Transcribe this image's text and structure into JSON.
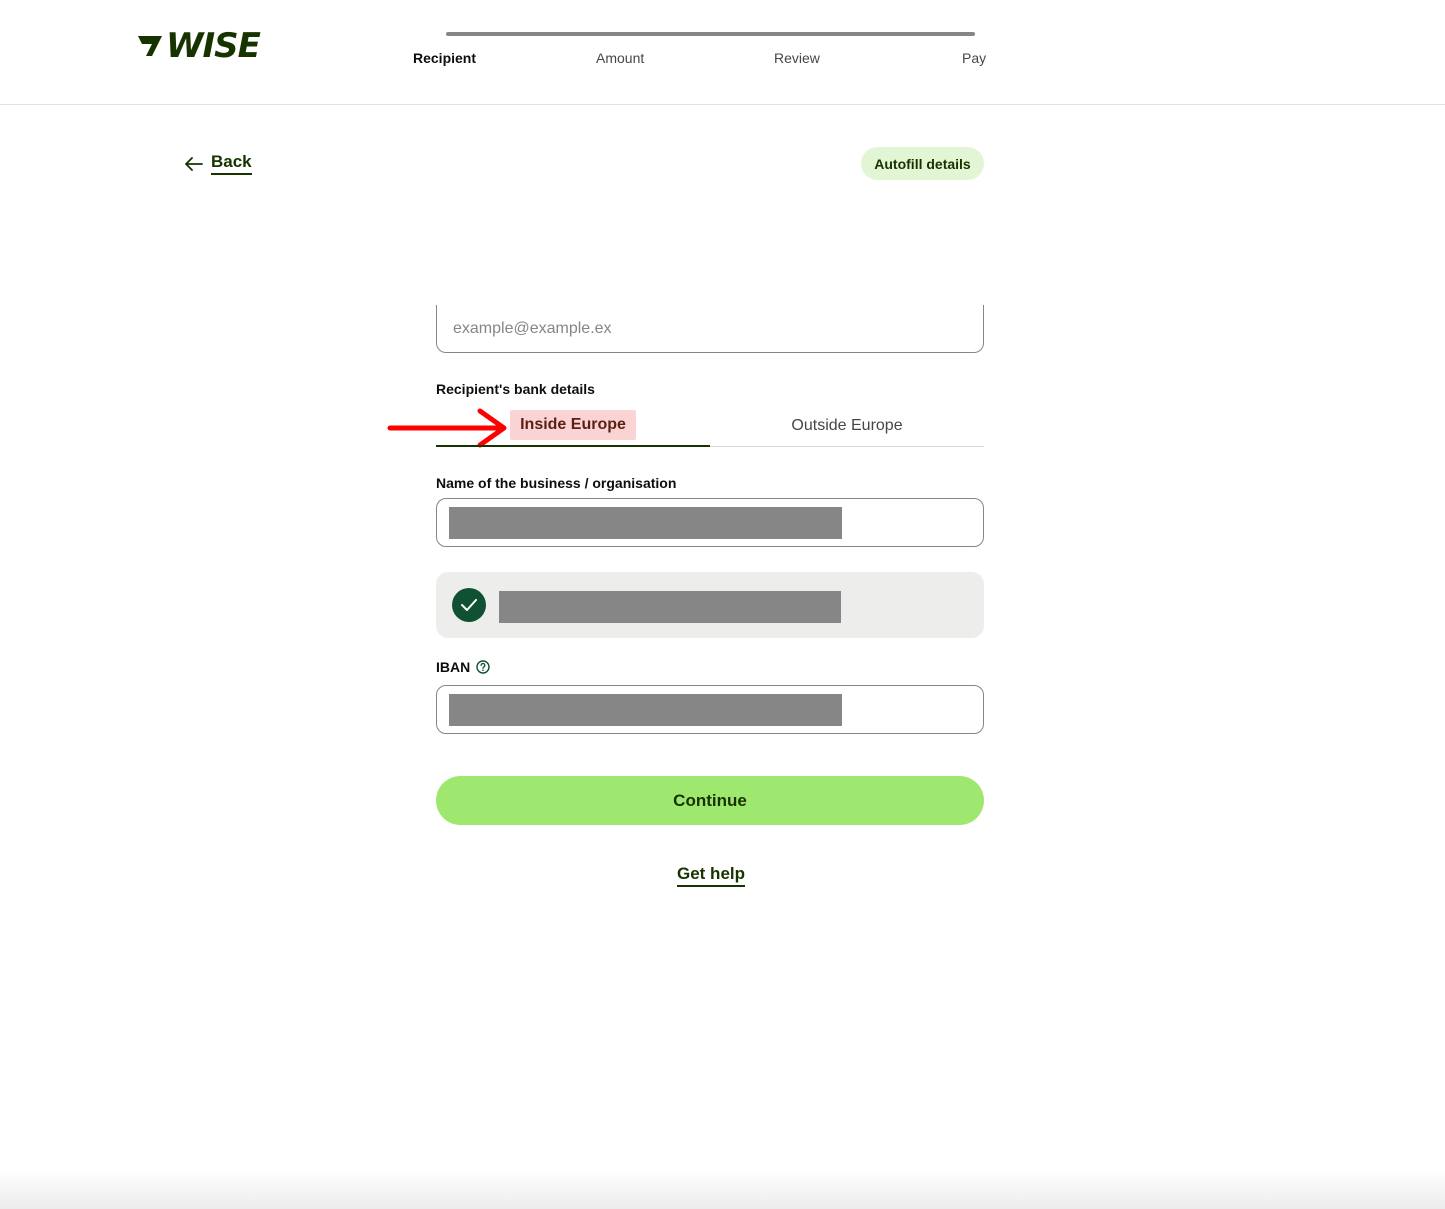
{
  "header": {
    "logo_text": "WISE",
    "brand_color": "#163300",
    "steps": [
      {
        "label": "Recipient",
        "active": true
      },
      {
        "label": "Amount",
        "active": false
      },
      {
        "label": "Review",
        "active": false
      },
      {
        "label": "Pay",
        "active": false
      }
    ]
  },
  "nav": {
    "back_label": "Back",
    "back_icon": "arrow-left-icon",
    "autofill_label": "Autofill details"
  },
  "form": {
    "email": {
      "placeholder": "example@example.ex",
      "value": ""
    },
    "bank_details_label": "Recipient's bank details",
    "tabs": [
      {
        "label": "Inside Europe",
        "selected": true
      },
      {
        "label": "Outside Europe",
        "selected": false
      }
    ],
    "business_name_label": "Name of the business / organisation",
    "business_name_value": "[redacted]",
    "verified_name_value": "[redacted]",
    "verified_icon": "check-circle-icon",
    "iban_label": "IBAN",
    "iban_help_icon": "question-circle-icon",
    "iban_value": "[redacted]",
    "continue_label": "Continue",
    "get_help_label": "Get help"
  },
  "annotation": {
    "arrow_icon": "red-arrow-icon",
    "arrow_color": "#ff0000",
    "highlight_color": "#fad4d4"
  },
  "colors": {
    "accent_green": "#9fe870",
    "light_green": "#e2f6d5",
    "dark_green": "#163300",
    "check_green": "#0f5132"
  }
}
